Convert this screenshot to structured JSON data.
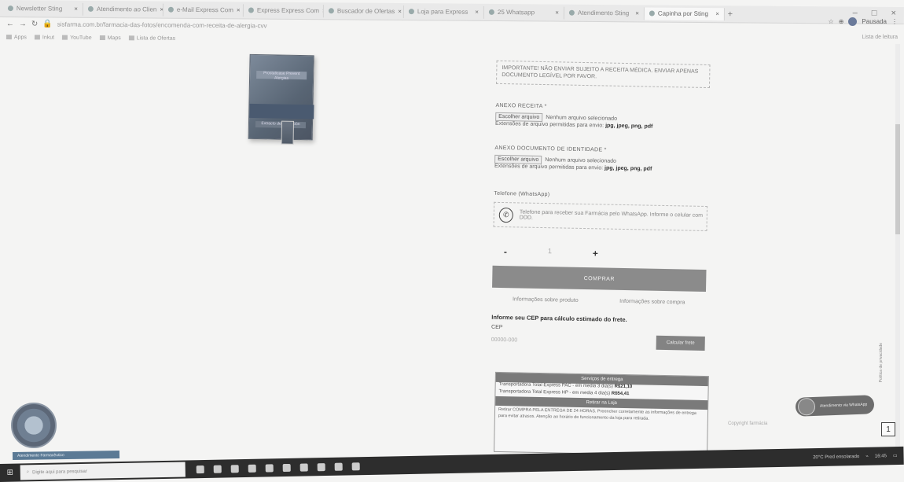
{
  "browser": {
    "tabs": [
      {
        "label": "Newsletter Sting"
      },
      {
        "label": "Atendimento ao Clien"
      },
      {
        "label": "e-Mail Express Com"
      },
      {
        "label": "Express Express Com"
      },
      {
        "label": "Buscador de Ofertas"
      },
      {
        "label": "Loja para Express"
      },
      {
        "label": "25 Whatsapp"
      },
      {
        "label": "Atendimento Sting"
      },
      {
        "label": "Capinha por Sting"
      }
    ],
    "new_tab": "+",
    "window_controls": [
      "–",
      "□",
      "×"
    ],
    "url": "sisfarma.com.br/farmacia-das-fotos/encomenda-com-receita-de-alergia-cvv",
    "profile_label": "Pausada",
    "reading_list": "Lista de leitura",
    "bookmarks": [
      {
        "label": "Apps"
      },
      {
        "label": "Inkut"
      },
      {
        "label": "YouTube"
      },
      {
        "label": "Maps"
      },
      {
        "label": "Lista de Ofertas"
      }
    ]
  },
  "product": {
    "box_line1": "Prostaticase Prevent Alergias",
    "box_line2": "Extracto de Aplicación"
  },
  "form": {
    "notice_text": "IMPORTANTE! NÃO ENVIAR SUJEITO A RECEITA MÉDICA. ENVIAR APENAS DOCUMENTO LEGÍVEL POR FAVOR.",
    "anexo_receita_label": "ANEXO RECEITA *",
    "choose_file_label": "Escolher arquivo",
    "no_file_text": "Nenhum arquivo selecionado",
    "formats_prefix": "Extensões de arquivo permitidas para envio:",
    "formats_value": "jpg, jpeg, png, pdf",
    "anexo_doc_label": "ANEXO DOCUMENTO DE IDENTIDADE *",
    "whatsapp_label": "Telefone (WhatsApp)",
    "whatsapp_text": "Telefone para receber sua Farmácia pelo WhatsApp. Informe o celular com DDD.",
    "qty_minus": "-",
    "qty_value": "1",
    "qty_plus": "+",
    "buy_label": "COMPRAR",
    "link_left": "Informações sobre produto",
    "link_right": "Informações sobre compra",
    "cep_title": "Informe seu CEP para cálculo estimado do frete.",
    "cep_label": "CEP",
    "cep_placeholder": "00000-000",
    "cep_button": "Calcular frete"
  },
  "shipping": {
    "header": "Serviços de entrega",
    "rows": [
      {
        "name": "Transportadora Total Express PAC - em media 3 dia(s)",
        "price": "R$21,10"
      },
      {
        "name": "Transportadora Total Express HP - em media 4 dia(s)",
        "price": "R$54,41"
      }
    ],
    "header2": "Retirar na Loja",
    "pickup_text": "Retirar COMPRA PELA ENTREGA DE 24 HORAS. Preencher corretamente as informações de entrega para evitar atrasos. Atenção ao horário de funcionamento da loja para retirada."
  },
  "widgets": {
    "chip_label": "Atendimento Farmacêutico",
    "chat_label": "Atendimento via WhatsApp",
    "side_text": "Política de privacidade",
    "page_badge": "1",
    "footer_faded": "Copyright farmácia"
  },
  "taskbar": {
    "search_placeholder": "Digite aqui para pesquisar",
    "tray_text": "20°C Pred ensolarado",
    "clock": "16:45"
  },
  "colors": {
    "buy_button": "#8b8b8b",
    "taskbar": "#2d2d2d",
    "page_bg": "#f4f4f3"
  }
}
